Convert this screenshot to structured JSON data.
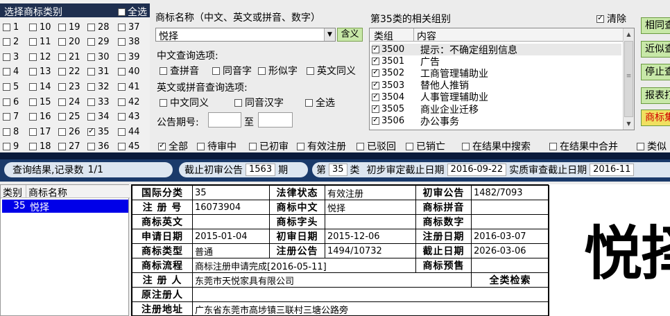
{
  "category_panel": {
    "title": "选择商标类别",
    "select_all": "全选",
    "columns": [
      [
        "1",
        "2",
        "3",
        "4",
        "5",
        "6",
        "7",
        "8",
        "9"
      ],
      [
        "10",
        "11",
        "12",
        "13",
        "14",
        "15",
        "16",
        "17",
        "18"
      ],
      [
        "19",
        "20",
        "21",
        "22",
        "23",
        "24",
        "25",
        "26",
        "27"
      ],
      [
        "28",
        "29",
        "30",
        "31",
        "32",
        "33",
        "34",
        "35",
        "36"
      ],
      [
        "37",
        "38",
        "39",
        "40",
        "41",
        "42",
        "43",
        "44",
        "45"
      ]
    ],
    "checked": [
      "35"
    ]
  },
  "search": {
    "name_label": "商标名称（中文、英文或拼音、数字）",
    "name_value": "悦择",
    "meaning_btn": "含义",
    "cn_options_label": "中文查询选项:",
    "cn_options": [
      "查拼音",
      "同音字",
      "形似字",
      "英文同义"
    ],
    "en_options_label": "英文或拼音查询选项:",
    "en_options": [
      "中文同义",
      "同音汉字",
      "全选"
    ],
    "period_label": "公告期号:",
    "period_to": "至"
  },
  "group": {
    "title": "第35类的相关组别",
    "clear": "清除",
    "col_group": "类组",
    "col_content": "内容",
    "rows": [
      {
        "code": "3500",
        "name": "提示：不确定组别信息"
      },
      {
        "code": "3501",
        "name": "广告"
      },
      {
        "code": "3502",
        "name": "工商管理辅助业"
      },
      {
        "code": "3503",
        "name": "替他人推销"
      },
      {
        "code": "3504",
        "name": "人事管理辅助业"
      },
      {
        "code": "3505",
        "name": "商业企业迁移"
      },
      {
        "code": "3506",
        "name": "办公事务"
      }
    ]
  },
  "side_buttons": [
    "相同查",
    "近似查",
    "停止查",
    "报表打",
    "商标集"
  ],
  "filters": [
    "全部",
    "待审中",
    "已初审",
    "有效注册",
    "已驳回",
    "已销亡",
    "在结果中搜索",
    "在结果中合并",
    "类似"
  ],
  "status": {
    "result_label": "查询结果,记录数",
    "result_count": "1/1",
    "cutoff_label": "截止初审公告",
    "cutoff_value": "1563",
    "cutoff_unit": "期",
    "class_prefix": "第",
    "class_value": "35",
    "class_suffix": "类",
    "prelim_label": "初步审定截止日期",
    "prelim_date": "2016-09-22",
    "subst_label": "实质审查截止日期",
    "subst_date": "2016-11"
  },
  "results": {
    "col_class": "类别",
    "col_name": "商标名称",
    "rows": [
      {
        "cls": "35",
        "name": "悦择"
      }
    ]
  },
  "detail": {
    "intl_class_k": "国际分类",
    "intl_class_v": "35",
    "legal_k": "法律状态",
    "legal_v": "有效注册",
    "prelim_k": "初审公告",
    "prelim_v": "1482/7093",
    "regno_k": "注 册 号",
    "regno_v": "16073904",
    "cn_k": "商标中文",
    "cn_v": "悦择",
    "py_k": "商标拼音",
    "py_v": "",
    "en_k": "商标英文",
    "en_v": "",
    "head_k": "商标字头",
    "head_v": "",
    "num_k": "商标数字",
    "num_v": "",
    "apply_k": "申请日期",
    "apply_v": "2015-01-04",
    "prelimdate_k": "初审日期",
    "prelimdate_v": "2015-12-06",
    "regdate_k": "注册日期",
    "regdate_v": "2016-03-07",
    "type_k": "商标类型",
    "type_v": "普通",
    "regpub_k": "注册公告",
    "regpub_v": "1494/10732",
    "expire_k": "截止日期",
    "expire_v": "2026-03-06",
    "flow_k": "商标流程",
    "flow_v": "商标注册申请完成[2016-05-11]",
    "warn_k": "商标预售",
    "warn_v": "",
    "reg_k": "注 册 人",
    "reg_v": "东莞市天悦家具有限公司",
    "all_search": "全类检索",
    "orig_k": "原注册人",
    "orig_v": "",
    "addr_k": "注册地址",
    "addr_v": "广东省东莞市高埗镇三联村三塘公路旁"
  },
  "preview": {
    "text": "悦择"
  }
}
